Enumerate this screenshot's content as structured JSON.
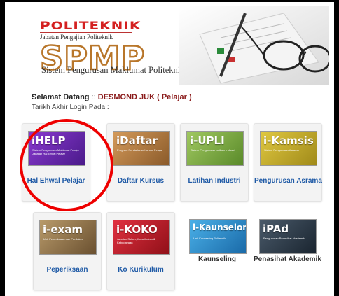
{
  "header": {
    "logo_top": "POLITEKNIK",
    "logo_sub": "Jabatan Pengajian Politeknik",
    "logo_big": "SPMP",
    "tagline": "Sistem Pengurusan Maklumat Politeknik"
  },
  "welcome": {
    "greeting": "Selamat Datang",
    "separator": "::",
    "user": "DESMOND JUK ( Pelajar )",
    "last_login": "Tarikh Akhir Login Pada :"
  },
  "tiles": [
    {
      "brand": "iHELP",
      "small": "Sistem Pengurusan Maklumat Pelajar Jabatan Hal Ehwal Pelajar",
      "label": "Hal Ehwal Pelajar",
      "color": "#6a2aa8"
    },
    {
      "brand": "iDaftar",
      "small": "Program Pendaftaran Kursus Pelajar",
      "label": "Daftar Kursus",
      "color": "#b87a3a"
    },
    {
      "brand": "i-UPLI",
      "small": "Sistem Pengurusan Latihan Industri",
      "label": "Latihan Industri",
      "color": "#7aa040"
    },
    {
      "brand": "i-Kamsis",
      "small": "Sistem Pengurusan Asrama",
      "label": "Pengurusan Asrama",
      "color": "#c9b02a"
    },
    {
      "brand": "i-exam",
      "small": "Unit Peperiksaan dan Penilaian",
      "label": "Peperiksaan",
      "color": "#9a7a4a"
    },
    {
      "brand": "i-KOKO",
      "small": "Jabatan Sukan, Kokurikulum & Kebudayaan",
      "label": "Ko Kurikulum",
      "color": "#c81e28"
    },
    {
      "brand": "i-Kaunselor",
      "small": "Unit Kaunseling Politeknik",
      "label": "Kaunseling",
      "color": "#2a88c8"
    },
    {
      "brand": "iPAd",
      "small": "Pengurusan Penasihat Akademik",
      "label": "Penasihat Akademik",
      "color": "#2a3a4a"
    }
  ]
}
